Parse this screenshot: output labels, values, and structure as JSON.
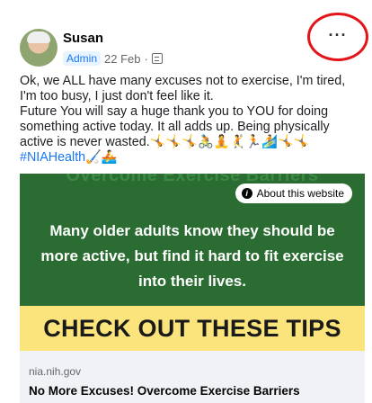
{
  "post": {
    "author": "Susan",
    "role_badge": "Admin",
    "date": "22 Feb",
    "separator": "·",
    "more_label": "···",
    "text_lines": [
      "Ok, we ALL have many excuses not to exercise, I'm tired,",
      "I'm too busy, I just don't feel like it.",
      "Future You will say a huge thank you to YOU for doing",
      "something active today. It all adds up. Being physically",
      "active is never wasted."
    ],
    "emojis_line1": "🤸🤸🤸🚴🧘🤾🏃🏄🤸🤸",
    "hashtag": "#NIAHealth",
    "emojis_line2": "🏑🚣"
  },
  "link": {
    "banner_ghost": "Overcome Exercise Barriers",
    "about_label": "About this website",
    "image_text": "Many older adults know they should be more active, but find it hard to fit exercise into their lives.",
    "tips_banner": "CHECK OUT THESE TIPS",
    "domain": "nia.nih.gov",
    "title": "No More Excuses! Overcome Exercise Barriers"
  },
  "colors": {
    "banner_green": "#2a6c31",
    "tips_yellow": "#fbe47b",
    "annotation_red": "#e3151a",
    "hashtag_blue": "#1877f2"
  }
}
